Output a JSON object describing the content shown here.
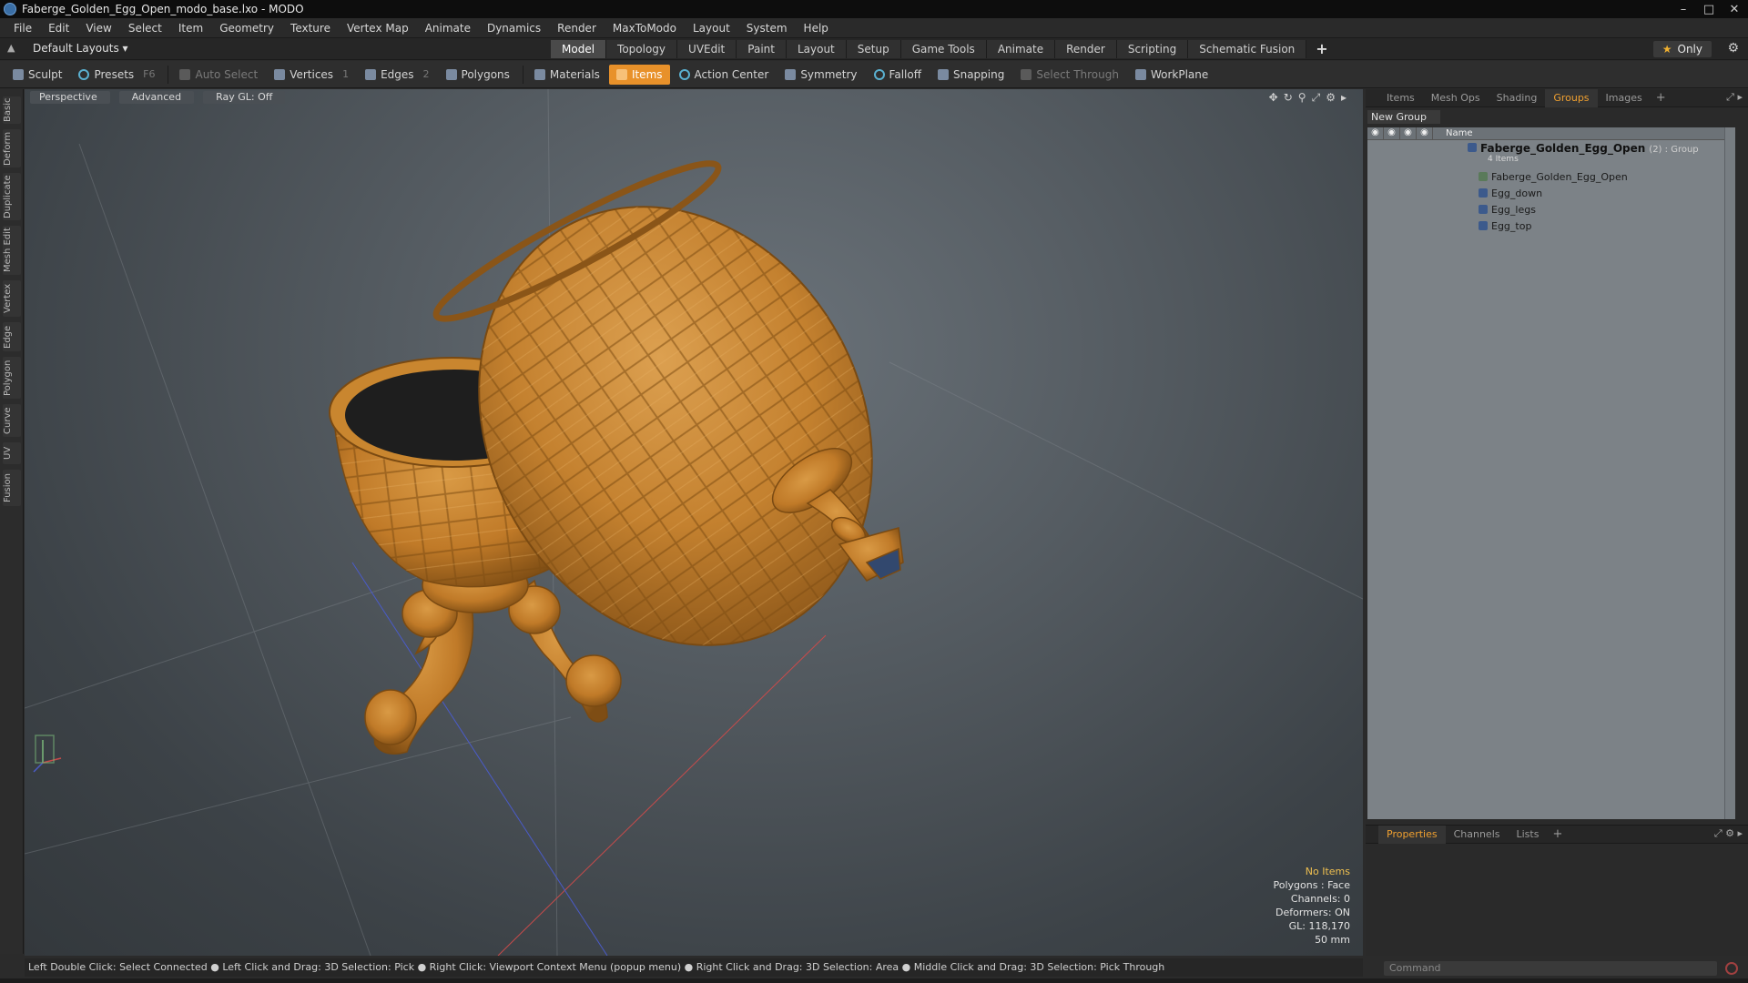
{
  "window": {
    "title": "Faberge_Golden_Egg_Open_modo_base.lxo - MODO"
  },
  "menubar": {
    "items": [
      "File",
      "Edit",
      "View",
      "Select",
      "Item",
      "Geometry",
      "Texture",
      "Vertex Map",
      "Animate",
      "Dynamics",
      "Render",
      "MaxToModo",
      "Layout",
      "System",
      "Help"
    ]
  },
  "layoutbar": {
    "layout_select": "Default Layouts ▾",
    "tabs": [
      "Model",
      "Topology",
      "UVEdit",
      "Paint",
      "Layout",
      "Setup",
      "Game Tools",
      "Animate",
      "Render",
      "Scripting",
      "Schematic Fusion"
    ],
    "active_tab": "Model",
    "add_tab": "+",
    "only_label": "Only"
  },
  "toolbar": {
    "sculpt": "Sculpt",
    "presets": "Presets",
    "presets_hotkey": "F6",
    "auto_select": "Auto Select",
    "vertices": "Vertices",
    "vertices_count": "1",
    "edges": "Edges",
    "edges_count": "2",
    "polygons": "Polygons",
    "materials": "Materials",
    "items": "Items",
    "action_center": "Action Center",
    "symmetry": "Symmetry",
    "falloff": "Falloff",
    "snapping": "Snapping",
    "select_through": "Select Through",
    "workplane": "WorkPlane"
  },
  "left_tabs": [
    "Basic",
    "Deform",
    "Duplicate",
    "Mesh Edit",
    "Vertex",
    "Edge",
    "Polygon",
    "Curve",
    "UV",
    "Fusion"
  ],
  "viewport": {
    "view_mode": "Perspective",
    "shading": "Advanced",
    "raygl": "Ray GL: Off",
    "stats": {
      "selection": "No Items",
      "polygons": "Polygons : Face",
      "channels": "Channels: 0",
      "deformers": "Deformers: ON",
      "gl": "GL: 118,170",
      "scale": "50 mm"
    },
    "colors": {
      "egg_gold": "#c8862e",
      "egg_shadow": "#8a5518",
      "egg_interior": "#1e1e1e"
    }
  },
  "right_panel": {
    "tabs": [
      "Items",
      "Mesh Ops",
      "Shading",
      "Groups",
      "Images"
    ],
    "active_tab": "Groups",
    "new_group": "New Group",
    "column_name": "Name",
    "group": {
      "name": "Faberge_Golden_Egg_Open",
      "count": "(2) : Group",
      "items_note": "4 Items"
    },
    "children": [
      "Faberge_Golden_Egg_Open",
      "Egg_down",
      "Egg_legs",
      "Egg_top"
    ]
  },
  "props_panel": {
    "tabs": [
      "Properties",
      "Channels",
      "Lists"
    ],
    "active_tab": "Properties"
  },
  "command": {
    "placeholder": "Command"
  },
  "statusbar": {
    "text": "Left Double Click: Select Connected ● Left Click and Drag: 3D Selection: Pick ● Right Click: Viewport Context Menu (popup menu) ● Right Click and Drag: 3D Selection: Area ● Middle Click and Drag: 3D Selection: Pick Through"
  }
}
